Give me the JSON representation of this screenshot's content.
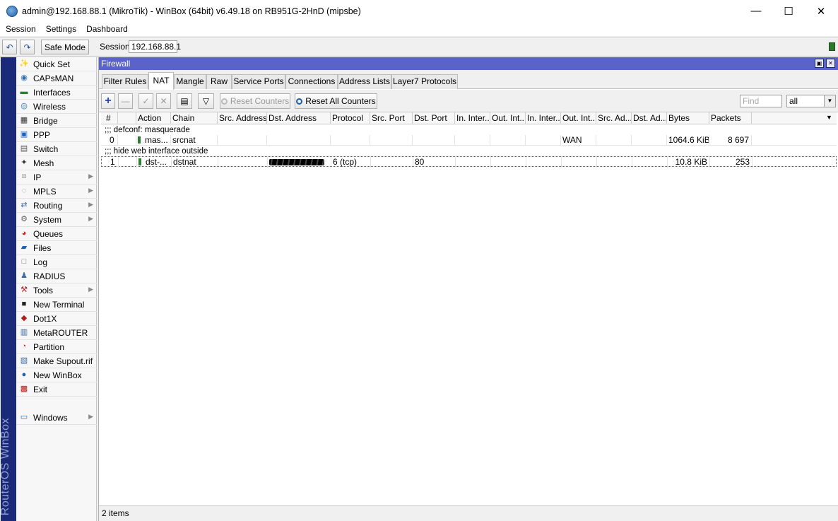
{
  "window": {
    "title": "admin@192.168.88.1 (MikroTik) - WinBox (64bit) v6.49.18 on RB951G-2HnD (mipsbe)",
    "minimize": "—",
    "maximize": "☐",
    "close": "✕"
  },
  "menu": [
    "Session",
    "Settings",
    "Dashboard"
  ],
  "toolbar": {
    "undo": "↶",
    "redo": "↷",
    "safe_mode": "Safe Mode",
    "session_label": "Session:",
    "session_value": "192.168.88.1"
  },
  "brand": "RouterOS WinBox",
  "sidebar": [
    {
      "label": "Quick Set",
      "icon": "✨",
      "color": "#c98a00",
      "submenu": false
    },
    {
      "label": "CAPsMAN",
      "icon": "◉",
      "color": "#2a6fb0",
      "submenu": false
    },
    {
      "label": "Interfaces",
      "icon": "▬",
      "color": "#2e7d32",
      "submenu": false
    },
    {
      "label": "Wireless",
      "icon": "◎",
      "color": "#1565c0",
      "submenu": false
    },
    {
      "label": "Bridge",
      "icon": "▦",
      "color": "#333333",
      "submenu": false
    },
    {
      "label": "PPP",
      "icon": "▣",
      "color": "#1565c0",
      "submenu": false
    },
    {
      "label": "Switch",
      "icon": "▤",
      "color": "#555555",
      "submenu": false
    },
    {
      "label": "Mesh",
      "icon": "✦",
      "color": "#333333",
      "submenu": false
    },
    {
      "label": "IP",
      "icon": "⌗",
      "color": "#333333",
      "submenu": true
    },
    {
      "label": "MPLS",
      "icon": "◌",
      "color": "#888888",
      "submenu": true
    },
    {
      "label": "Routing",
      "icon": "⇄",
      "color": "#3b6aa0",
      "submenu": true
    },
    {
      "label": "System",
      "icon": "⚙",
      "color": "#666666",
      "submenu": true
    },
    {
      "label": "Queues",
      "icon": "◕",
      "color": "#c62828",
      "submenu": false
    },
    {
      "label": "Files",
      "icon": "▰",
      "color": "#1565c0",
      "submenu": false
    },
    {
      "label": "Log",
      "icon": "□",
      "color": "#777777",
      "submenu": false
    },
    {
      "label": "RADIUS",
      "icon": "♟",
      "color": "#3b6aa0",
      "submenu": false
    },
    {
      "label": "Tools",
      "icon": "⚒",
      "color": "#b71c1c",
      "submenu": true
    },
    {
      "label": "New Terminal",
      "icon": "■",
      "color": "#222222",
      "submenu": false
    },
    {
      "label": "Dot1X",
      "icon": "◆",
      "color": "#b71c1c",
      "submenu": false
    },
    {
      "label": "MetaROUTER",
      "icon": "▥",
      "color": "#3b6aa0",
      "submenu": false
    },
    {
      "label": "Partition",
      "icon": "◔",
      "color": "#c62828",
      "submenu": false
    },
    {
      "label": "Make Supout.rif",
      "icon": "▧",
      "color": "#3b6aa0",
      "submenu": false
    },
    {
      "label": "New WinBox",
      "icon": "●",
      "color": "#1f5fa8",
      "submenu": false
    },
    {
      "label": "Exit",
      "icon": "▩",
      "color": "#b71c1c",
      "submenu": false
    },
    {
      "label": "",
      "icon": "",
      "color": "#f7f7f7",
      "submenu": false
    },
    {
      "label": "Windows",
      "icon": "▭",
      "color": "#1565c0",
      "submenu": true
    }
  ],
  "firewall": {
    "title": "Firewall",
    "restore_btn": "▣",
    "close_btn": "✕",
    "tabs": [
      "Filter Rules",
      "NAT",
      "Mangle",
      "Raw",
      "Service Ports",
      "Connections",
      "Address Lists",
      "Layer7 Protocols"
    ],
    "active_tab": "NAT",
    "actions": {
      "add": "+",
      "remove": "—",
      "enable": "✓",
      "disable": "✕",
      "comment": "▤",
      "filter": "▽",
      "reset_counters": "Reset Counters",
      "reset_all_counters": "Reset All Counters"
    },
    "find_placeholder": "Find",
    "filter_value": "all",
    "columns": [
      "#",
      "",
      "Action",
      "Chain",
      "Src. Address",
      "Dst. Address",
      "Protocol",
      "Src. Port",
      "Dst. Port",
      "In. Inter...",
      "Out. Int...",
      "In. Inter...",
      "Out. Int...",
      "Src. Ad...",
      "Dst. Ad...",
      "Bytes",
      "Packets"
    ],
    "rules": [
      {
        "comment": ";;; defconf: masquerade",
        "num": "0",
        "action": "mas...",
        "chain": "srcnat",
        "protocol": "",
        "dst_port": "",
        "out_int": "WAN",
        "bytes": "1064.6 KiB",
        "packets": "8 697"
      },
      {
        "comment": ";;; hide web interface outside",
        "num": "1",
        "action": "dst-...",
        "chain": "dstnat",
        "protocol": "6 (tcp)",
        "dst_port": "80",
        "out_int": "",
        "bytes": "10.8 KiB",
        "packets": "253"
      }
    ],
    "status": "2 items"
  }
}
